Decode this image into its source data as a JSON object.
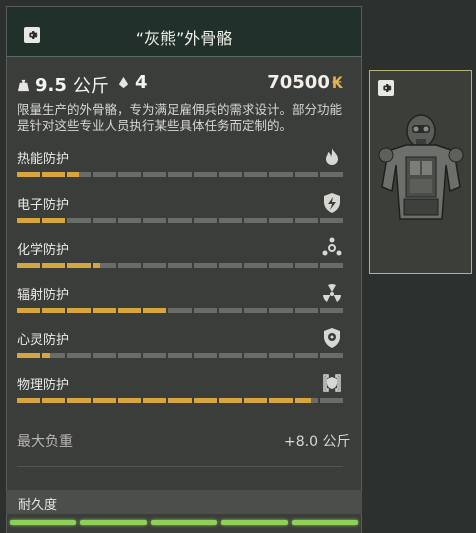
{
  "item": {
    "title": "“灰熊”外骨骼",
    "weight_value": "9.5",
    "weight_unit": "公斤",
    "slots": "4",
    "price": "70500",
    "price_currency": "₭",
    "description": "限量生产的外骨骼，专为满足雇佣兵的需求设计。部分功能是针对这些专业人员执行某些具体任务而定制的。"
  },
  "protections": [
    {
      "label": "热能防护",
      "icon": "flame-icon",
      "segments": [
        1,
        1,
        0.5,
        0,
        0,
        0,
        0,
        0,
        0,
        0,
        0,
        0,
        0
      ]
    },
    {
      "label": "电子防护",
      "icon": "lightning-shield-icon",
      "segments": [
        1,
        1,
        0,
        0,
        0,
        0,
        0,
        0,
        0,
        0,
        0,
        0,
        0
      ]
    },
    {
      "label": "化学防护",
      "icon": "biohazard-icon",
      "segments": [
        1,
        1,
        1,
        0.3,
        0,
        0,
        0,
        0,
        0,
        0,
        0,
        0,
        0
      ]
    },
    {
      "label": "辐射防护",
      "icon": "radiation-icon",
      "segments": [
        1,
        1,
        1,
        1,
        1,
        1,
        0,
        0,
        0,
        0,
        0,
        0,
        0
      ]
    },
    {
      "label": "心灵防护",
      "icon": "psy-shield-icon",
      "segments": [
        1,
        0.35,
        0,
        0,
        0,
        0,
        0,
        0,
        0,
        0,
        0,
        0,
        0
      ]
    },
    {
      "label": "物理防护",
      "icon": "armor-icon",
      "segments": [
        1,
        1,
        1,
        1,
        1,
        1,
        1,
        1,
        1,
        1,
        1,
        0.7,
        0
      ]
    }
  ],
  "max_load": {
    "label": "最大负重",
    "value": "+8.0 公斤"
  },
  "durability": {
    "label": "耐久度",
    "segments": 5
  },
  "colors": {
    "accent": "#d6a53c",
    "durability": "#8fd05a",
    "price_currency": "#e3b34c"
  }
}
